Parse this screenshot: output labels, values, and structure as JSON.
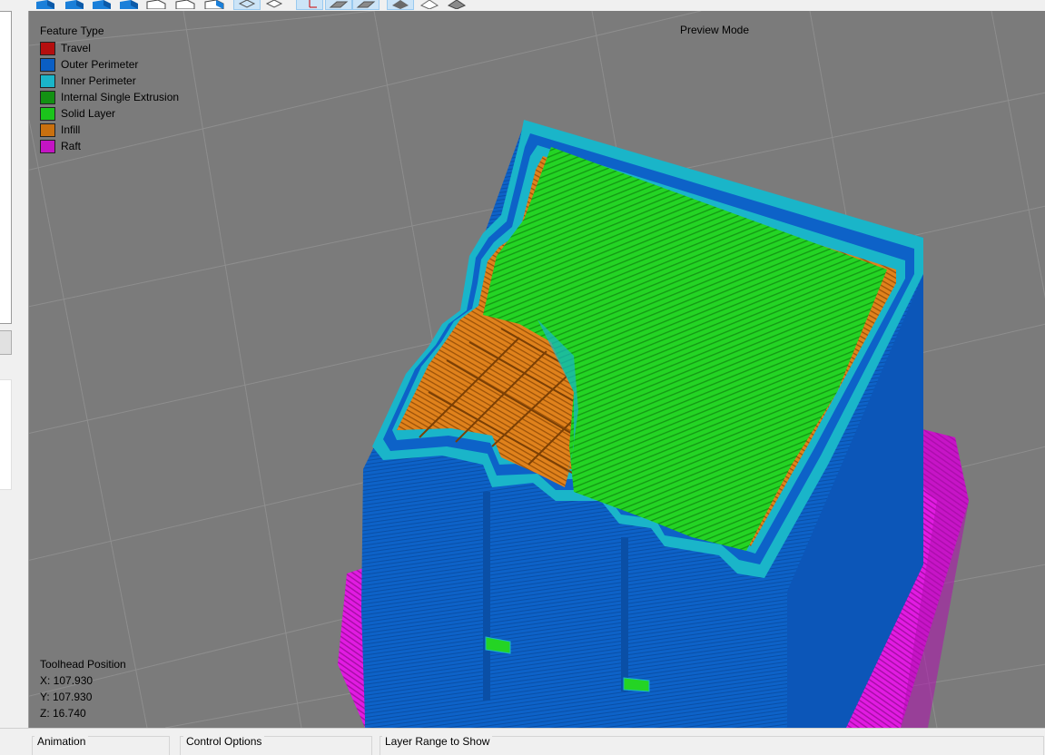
{
  "toolbar": {
    "buttons": [
      {
        "icon": "cube-view-iso-icon",
        "active": false
      },
      {
        "icon": "cube-view-front-icon",
        "active": false
      },
      {
        "icon": "cube-view-back-icon",
        "active": false
      },
      {
        "icon": "cube-view-left-icon",
        "active": false
      },
      {
        "icon": "cube-view-right-icon",
        "active": false
      },
      {
        "icon": "cube-view-top-icon",
        "active": false
      },
      {
        "icon": "cube-view-bottom-icon",
        "active": false
      },
      {
        "icon": "wireframe-view-icon",
        "active": true
      },
      {
        "icon": "solid-view-icon",
        "active": false
      },
      {
        "icon": "axis-view-icon",
        "active": true
      },
      {
        "icon": "shaded-view-icon",
        "active": true
      },
      {
        "icon": "flat-view-icon",
        "active": true
      },
      {
        "icon": "gray-model-icon",
        "active": true
      },
      {
        "icon": "light-model-icon",
        "active": false
      },
      {
        "icon": "dark-model-icon",
        "active": false
      }
    ]
  },
  "legend": {
    "title": "Feature Type",
    "items": [
      {
        "label": "Travel",
        "color": "#b50f0f"
      },
      {
        "label": "Outer Perimeter",
        "color": "#0a5ec4"
      },
      {
        "label": "Inner Perimeter",
        "color": "#1ab5c9"
      },
      {
        "label": "Internal Single Extrusion",
        "color": "#139113"
      },
      {
        "label": "Solid Layer",
        "color": "#1bc41b"
      },
      {
        "label": "Infill",
        "color": "#c9700f"
      },
      {
        "label": "Raft",
        "color": "#c414c4"
      }
    ]
  },
  "viewport": {
    "mode_label": "Preview Mode",
    "background": "#7b7b7b",
    "grid_color": "#8e8e8e"
  },
  "toolhead": {
    "title": "Toolhead Position",
    "x": "X: 107.930",
    "y": "Y: 107.930",
    "z": "Z: 16.740"
  },
  "bottom_panel": {
    "groups": [
      "Animation",
      "Control Options",
      "Layer Range to Show"
    ]
  }
}
